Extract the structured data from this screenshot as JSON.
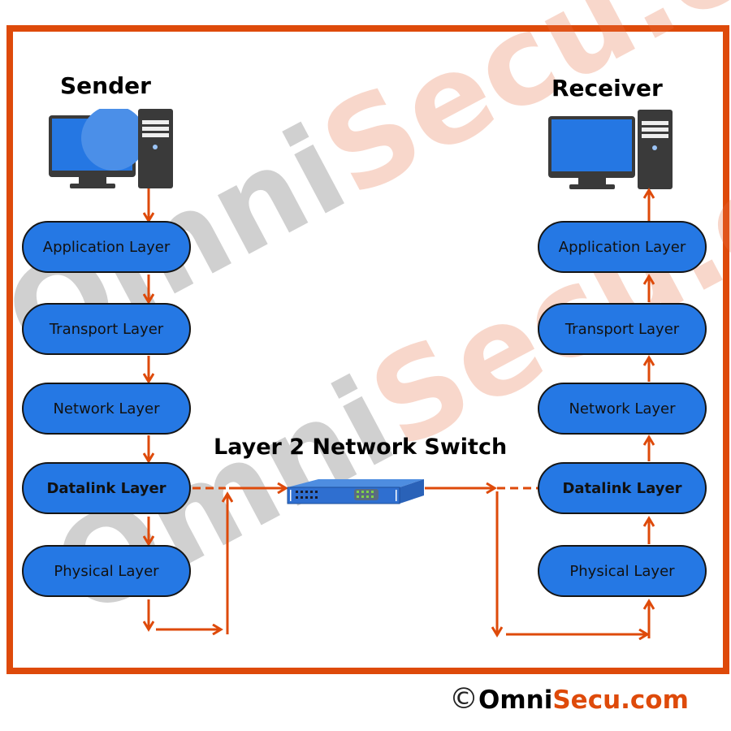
{
  "watermark": {
    "text_gray": "Omni",
    "text_orange": "Secu.com"
  },
  "sender": {
    "title": "Sender",
    "layers": [
      {
        "label": "Application Layer",
        "bold": false
      },
      {
        "label": "Transport Layer",
        "bold": false
      },
      {
        "label": "Network Layer",
        "bold": false
      },
      {
        "label": "Datalink Layer",
        "bold": true
      },
      {
        "label": "Physical Layer",
        "bold": false
      }
    ]
  },
  "receiver": {
    "title": "Receiver",
    "layers": [
      {
        "label": "Application Layer",
        "bold": false
      },
      {
        "label": "Transport Layer",
        "bold": false
      },
      {
        "label": "Network Layer",
        "bold": false
      },
      {
        "label": "Datalink Layer",
        "bold": true
      },
      {
        "label": "Physical Layer",
        "bold": false
      }
    ]
  },
  "switch": {
    "title": "Layer 2 Network Switch",
    "icon": "network-switch-icon"
  },
  "footer": {
    "copyright_symbol": "©",
    "brand_part1": "Omni",
    "brand_part2": "Secu.com"
  },
  "colors": {
    "frame": "#de4a0a",
    "arrow": "#de4a0a",
    "layer_fill": "#2578e4",
    "layer_border": "#151515"
  }
}
